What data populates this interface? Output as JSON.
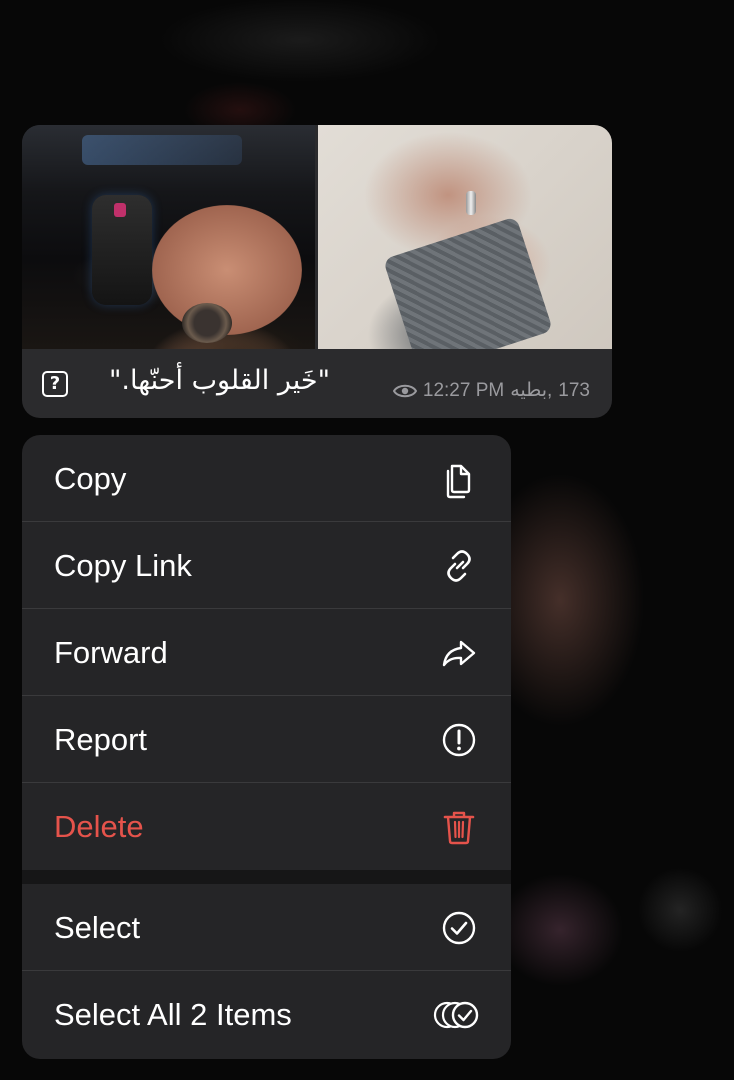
{
  "message": {
    "caption": "\"خَير القلوب أحنّها.\"",
    "caption_icon": "?",
    "views": "173",
    "author": "بطيه,",
    "time": "12:27 PM",
    "photos": [
      "photo-car-hand",
      "photo-hands-ring"
    ]
  },
  "menu": {
    "items": [
      {
        "label": "Copy",
        "icon": "copy-icon"
      },
      {
        "label": "Copy Link",
        "icon": "link-icon"
      },
      {
        "label": "Forward",
        "icon": "forward-icon"
      },
      {
        "label": "Report",
        "icon": "report-icon"
      },
      {
        "label": "Delete",
        "icon": "trash-icon",
        "color": "#e5534b"
      },
      {
        "label": "Select",
        "icon": "check-circle-icon"
      },
      {
        "label": "Select All 2 Items",
        "icon": "select-all-icon"
      }
    ]
  },
  "colors": {
    "menu_bg": "#252527",
    "danger": "#e5534b",
    "meta_text": "#9a9a9e"
  }
}
